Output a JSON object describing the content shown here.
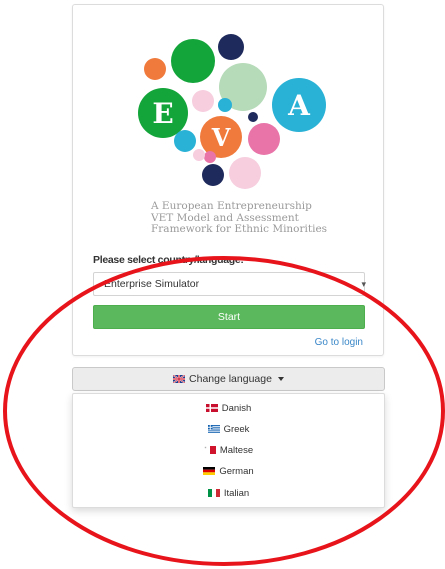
{
  "logo": {
    "letters": [
      "E",
      "V",
      "A"
    ],
    "colors": {
      "green": "#13a43a",
      "navy": "#1f2a5c",
      "orange": "#f07a3c",
      "pink": "#e874a8",
      "cyan": "#29b1d6",
      "lightgreen": "#b6dbb9",
      "lightpink": "#f6cede"
    }
  },
  "tagline": {
    "line1": "A European Entrepreneurship",
    "line2": "VET Model and Assessment",
    "line3": "Framework for Ethnic Minorities"
  },
  "form": {
    "select_label": "Please select country/language:",
    "select_value": "Enterprise Simulator",
    "start_label": "Start",
    "login_link": "Go to login"
  },
  "language": {
    "button_label": "Change language",
    "options": [
      {
        "label": "Danish",
        "flag": "flag-dk-icon"
      },
      {
        "label": "Greek",
        "flag": "flag-gr-icon"
      },
      {
        "label": "Maltese",
        "flag": "flag-mt-icon"
      },
      {
        "label": "German",
        "flag": "flag-de-icon"
      },
      {
        "label": "Italian",
        "flag": "flag-it-icon"
      }
    ]
  },
  "colors": {
    "start_button": "#5cb85c",
    "link": "#3a87c8",
    "annotation": "#e8141b"
  }
}
